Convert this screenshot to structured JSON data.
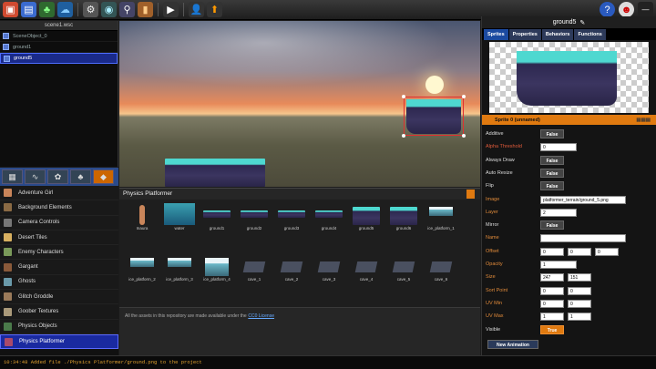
{
  "toolbar": {
    "icons": [
      "new-icon",
      "save-icon",
      "plant-icon",
      "cloud-icon",
      "settings-icon",
      "view-icon",
      "search-icon",
      "barrel-icon",
      "play-icon",
      "user-icon",
      "export-icon",
      "help-icon",
      "account-icon"
    ]
  },
  "scene": {
    "title": "scene1.wsc",
    "items": [
      {
        "label": "SceneObject_0",
        "selected": false
      },
      {
        "label": "ground1",
        "selected": false
      },
      {
        "label": "ground5",
        "selected": true
      }
    ]
  },
  "categories": {
    "items": [
      {
        "label": "Adventure Girl",
        "color": "#c9855a"
      },
      {
        "label": "Background Elements",
        "color": "#8a6a44"
      },
      {
        "label": "Camera Controls",
        "color": "#777777"
      },
      {
        "label": "Desert Tiles",
        "color": "#d8b060"
      },
      {
        "label": "Enemy Characters",
        "color": "#7a9a5a"
      },
      {
        "label": "Gargant",
        "color": "#8a5a3a"
      },
      {
        "label": "Ghosts",
        "color": "#6a9aaa"
      },
      {
        "label": "Glitch Groddle",
        "color": "#9a7a5a"
      },
      {
        "label": "Goober Textures",
        "color": "#aa9a7a"
      },
      {
        "label": "Physics Objects",
        "color": "#4a7a4a"
      },
      {
        "label": "Physics Platformer",
        "color": "#aa4a6a",
        "selected": true
      }
    ]
  },
  "assets": {
    "title": "Physics Platformer",
    "items": [
      {
        "label": "Inaura"
      },
      {
        "label": "water"
      },
      {
        "label": "ground1"
      },
      {
        "label": "ground2"
      },
      {
        "label": "ground3"
      },
      {
        "label": "ground4"
      },
      {
        "label": "ground5"
      },
      {
        "label": "ground6"
      },
      {
        "label": "ice_platform_1"
      },
      {
        "label": "ice_platform_2"
      },
      {
        "label": "ice_platform_3"
      },
      {
        "label": "ice_platform_4"
      },
      {
        "label": "cave_1"
      },
      {
        "label": "cave_2"
      },
      {
        "label": "cave_3"
      },
      {
        "label": "cave_4"
      },
      {
        "label": "cave_5"
      },
      {
        "label": "cave_6"
      }
    ],
    "footer_text": "All the assets in this repository are made available under the",
    "footer_link": "CC0 License"
  },
  "inspector": {
    "title": "ground5",
    "tabs": [
      {
        "label": "Sprites",
        "selected": true
      },
      {
        "label": "Properties"
      },
      {
        "label": "Behaviors"
      },
      {
        "label": "Functions"
      }
    ],
    "sprite_header": "Sprite 0 (unnamed)",
    "new_animation": "New Animation",
    "props": {
      "additive": {
        "label": "Additive",
        "value": "False"
      },
      "alpha": {
        "label": "Alpha Threshold",
        "value": "0"
      },
      "always_draw": {
        "label": "Always Draw",
        "value": "False"
      },
      "auto_resize": {
        "label": "Auto Resize",
        "value": "False"
      },
      "flip": {
        "label": "Flip",
        "value": "False"
      },
      "image": {
        "label": "Image",
        "value": "platformer_terrain/ground_5.png"
      },
      "layer": {
        "label": "Layer",
        "value": "2"
      },
      "mirror": {
        "label": "Mirror",
        "value": "False"
      },
      "name": {
        "label": "Name",
        "value": ""
      },
      "offset": {
        "label": "Offset",
        "x": "0",
        "y": "0",
        "z": "0"
      },
      "opacity": {
        "label": "Opacity",
        "value": "1"
      },
      "size": {
        "label": "Size",
        "w": "247",
        "h": "151"
      },
      "sort": {
        "label": "Sort Point",
        "x": "0",
        "y": "0"
      },
      "uvmin": {
        "label": "UV Min",
        "x": "0",
        "y": "0"
      },
      "uvmax": {
        "label": "UV Max",
        "x": "1",
        "y": "1"
      },
      "visible": {
        "label": "Visible",
        "value": "True"
      }
    }
  },
  "status": "10:34:48 Added file ./Physics Platformer/ground.png to the project",
  "colors": {
    "accent": "#e07a10",
    "selection": "#1a2aa0",
    "status_text": "#e0a030"
  }
}
